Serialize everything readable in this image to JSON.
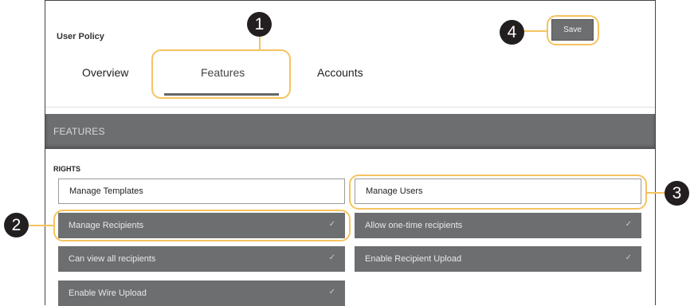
{
  "header": {
    "title": "User Policy",
    "save_label": "Save"
  },
  "tabs": [
    {
      "label": "Overview"
    },
    {
      "label": "Features"
    },
    {
      "label": "Accounts"
    }
  ],
  "section": {
    "title": "FEATURES",
    "group_label": "RIGHTS"
  },
  "rights": [
    {
      "label": "Manage Templates",
      "checked": false
    },
    {
      "label": "Manage Users",
      "checked": false
    },
    {
      "label": "Manage Recipients",
      "checked": true
    },
    {
      "label": "Allow one-time recipients",
      "checked": true
    },
    {
      "label": "Can view all recipients",
      "checked": true
    },
    {
      "label": "Enable Recipient Upload",
      "checked": true
    },
    {
      "label": "Enable Wire Upload",
      "checked": true
    }
  ],
  "check_glyph": "✓",
  "callouts": [
    "1",
    "2",
    "3",
    "4"
  ],
  "colors": {
    "accent_ring": "#f5c35f",
    "selected_chip": "#6d6e70",
    "marker": "#231f20"
  }
}
